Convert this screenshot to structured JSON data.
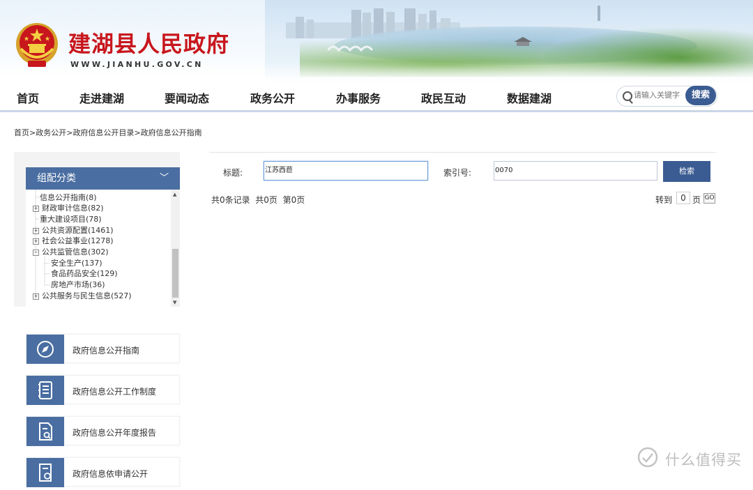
{
  "header": {
    "site_title": "建湖县人民政府",
    "site_url": "WWW.JIANHU.GOV.CN"
  },
  "nav": {
    "items": [
      {
        "label": "首页"
      },
      {
        "label": "走进建湖"
      },
      {
        "label": "要闻动态"
      },
      {
        "label": "政务公开"
      },
      {
        "label": "办事服务"
      },
      {
        "label": "政民互动"
      },
      {
        "label": "数据建湖"
      }
    ],
    "search_placeholder": "请输入关键字",
    "search_button": "搜索"
  },
  "breadcrumb": [
    "首页",
    ">",
    "政务公开",
    ">",
    "政府信息公开目录",
    ">",
    "政府信息公开指南"
  ],
  "sidebar": {
    "tree_title": "组配分类",
    "tree_items": [
      {
        "label": "信息公开指南(8)",
        "expandable": false,
        "indent": 0
      },
      {
        "label": "财政审计信息(82)",
        "expandable": true,
        "indent": 0
      },
      {
        "label": "重大建设项目(78)",
        "expandable": false,
        "indent": 0
      },
      {
        "label": "公共资源配置(1461)",
        "expandable": true,
        "indent": 0
      },
      {
        "label": "社会公益事业(1278)",
        "expandable": true,
        "indent": 0
      },
      {
        "label": "公共监管信息(302)",
        "expandable": true,
        "expanded": true,
        "indent": 0
      },
      {
        "label": "安全生产(137)",
        "expandable": false,
        "indent": 1
      },
      {
        "label": "食品药品安全(129)",
        "expandable": false,
        "indent": 1
      },
      {
        "label": "房地产市场(36)",
        "expandable": false,
        "indent": 1
      },
      {
        "label": "公共服务与民生信息(527)",
        "expandable": true,
        "indent": 0
      }
    ],
    "links": [
      {
        "label": "政府信息公开指南",
        "icon": "compass-icon"
      },
      {
        "label": "政府信息公开工作制度",
        "icon": "document-list-icon"
      },
      {
        "label": "政府信息公开年度报告",
        "icon": "report-icon"
      },
      {
        "label": "政府信息依申请公开",
        "icon": "application-icon"
      }
    ]
  },
  "search_form": {
    "title_label": "标题:",
    "title_value": "江苏西苣",
    "index_label": "索引号:",
    "index_value": "0070",
    "retrieve_button": "检索"
  },
  "pager": {
    "total_records": "共0条记录",
    "total_pages": "共0页",
    "current_page": "第0页",
    "goto_label": "转到",
    "goto_value": "0",
    "page_unit": "页",
    "go_button": "GO"
  },
  "watermark": {
    "text": "什么值得买"
  },
  "colors": {
    "title_red": "#c8161d",
    "accent_blue": "#3b5c92",
    "panel_blue": "#4a6ea1"
  }
}
